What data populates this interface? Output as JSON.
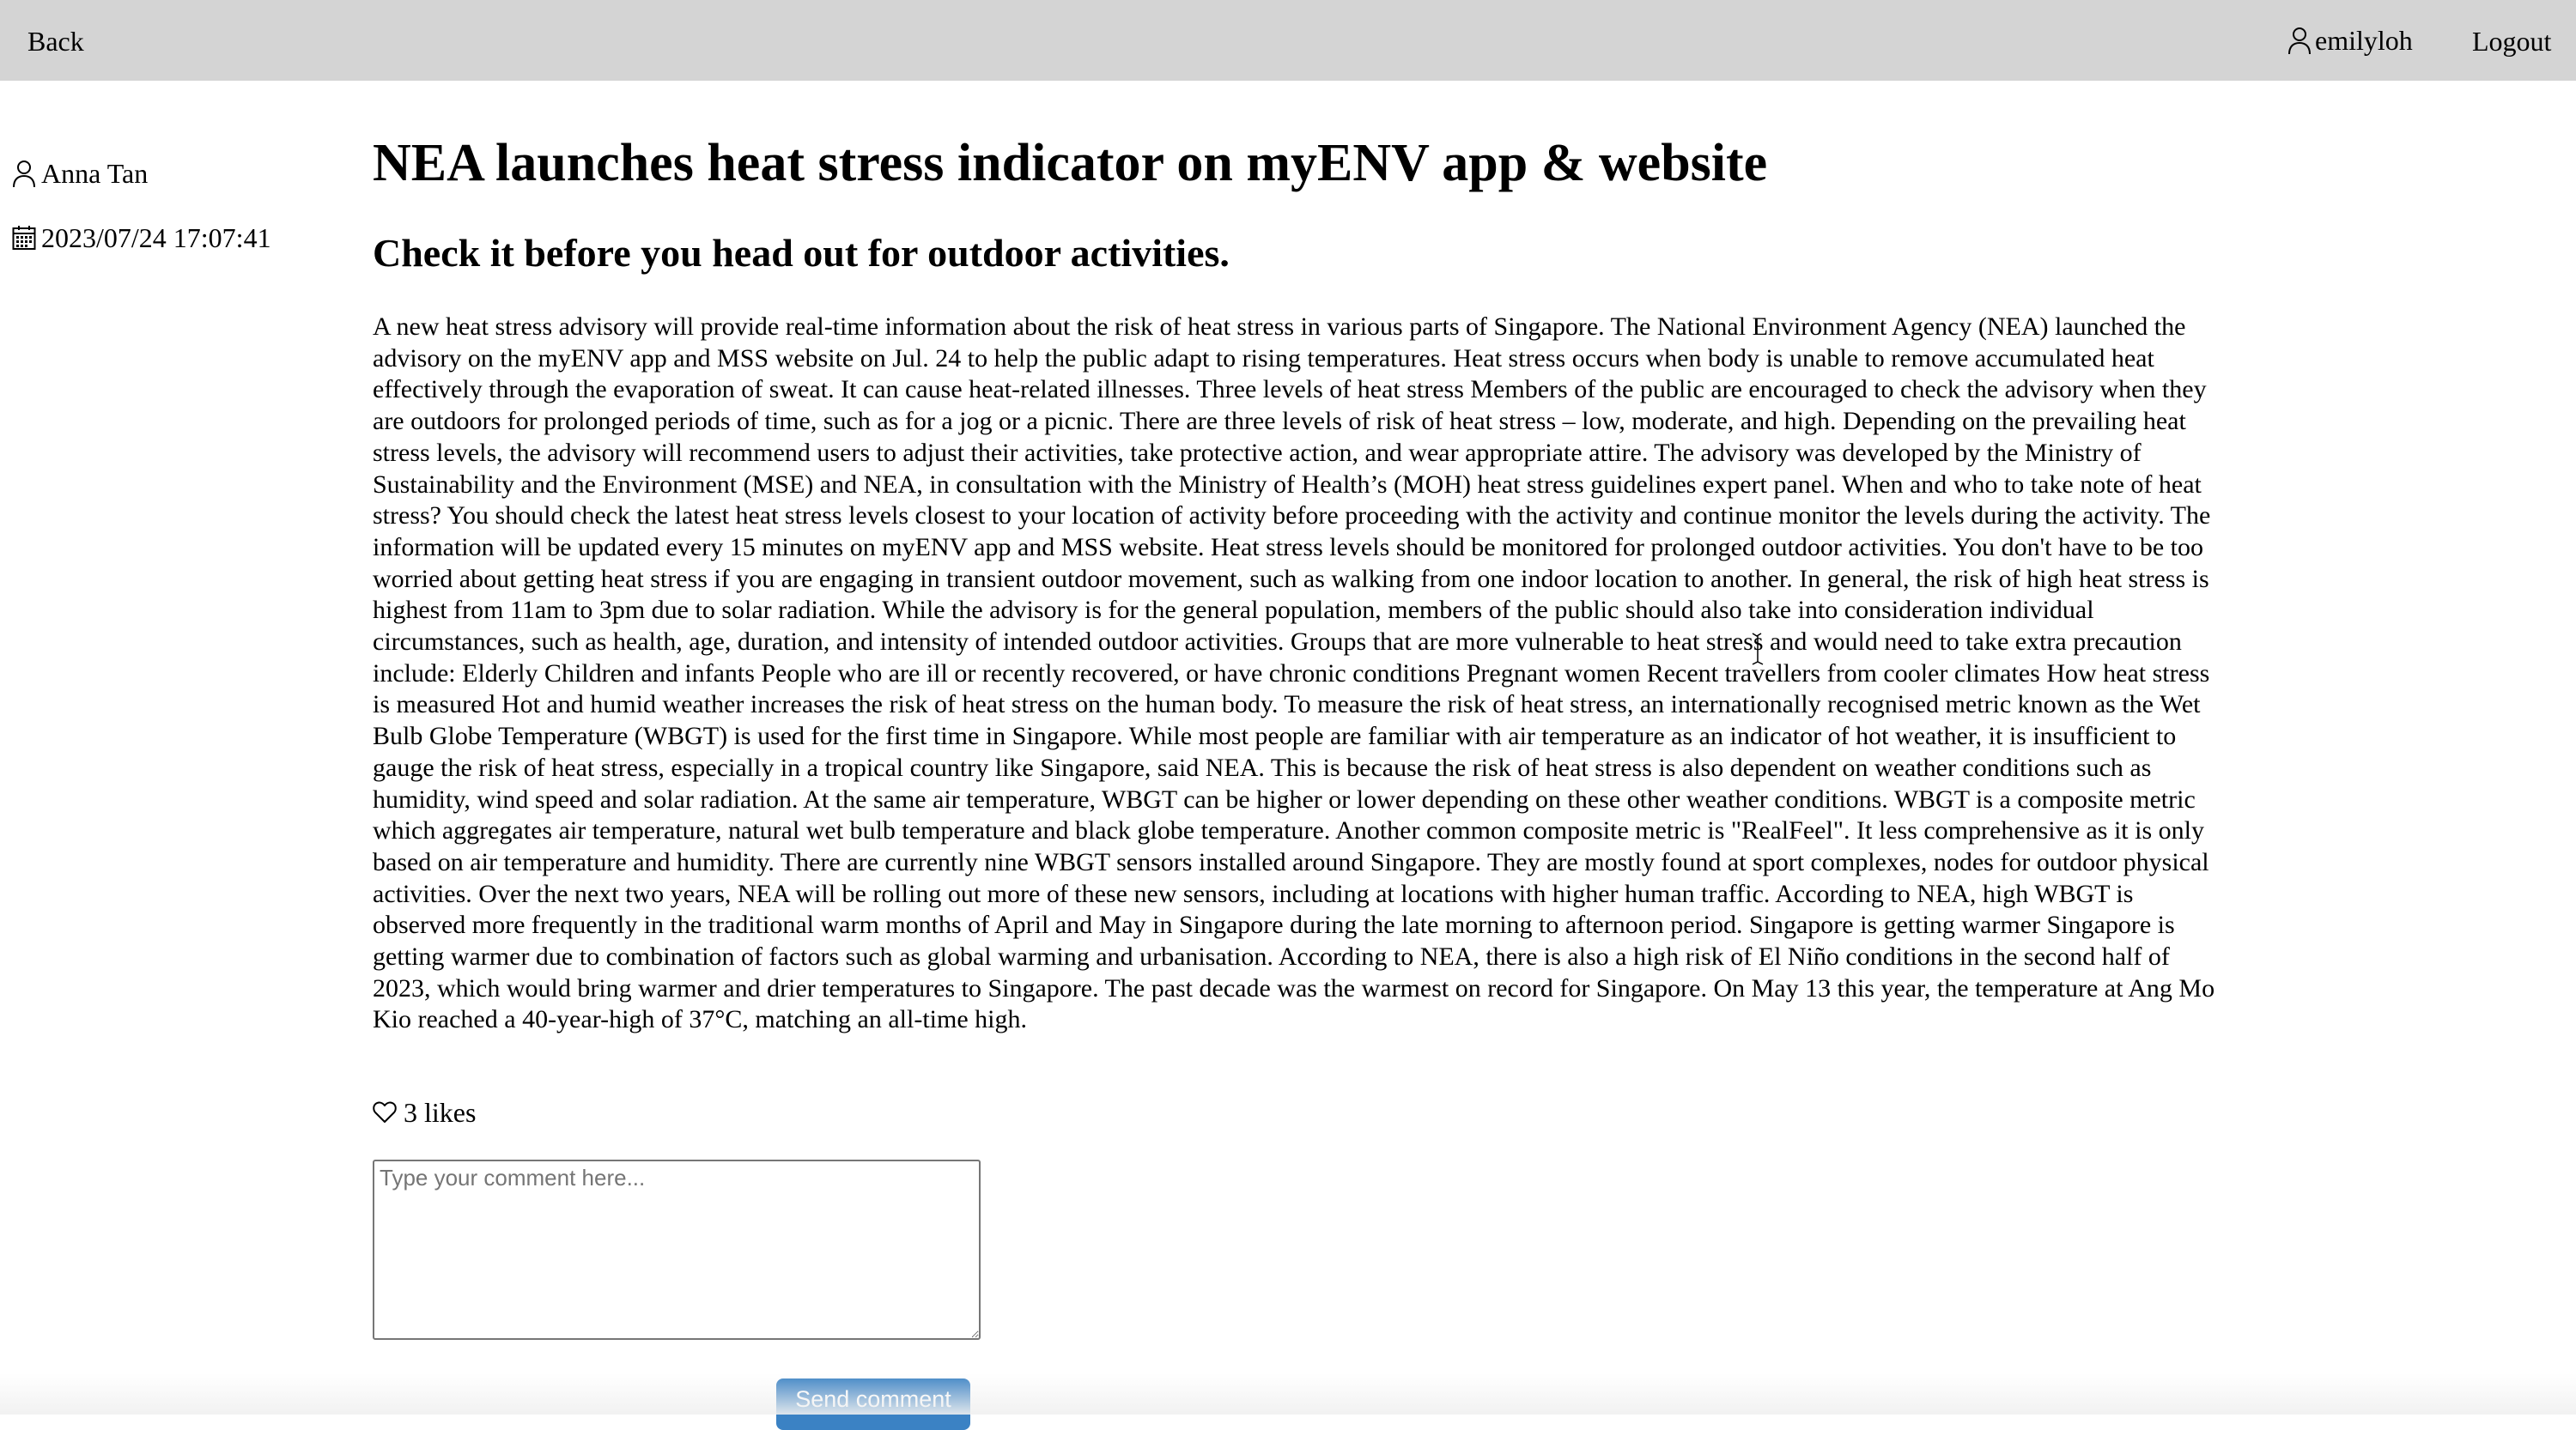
{
  "nav": {
    "back_label": "Back",
    "username": "emilyloh",
    "logout_label": "Logout"
  },
  "post": {
    "author": "Anna Tan",
    "timestamp": "2023/07/24 17:07:41",
    "title": "NEA launches heat stress indicator on myENV app & website",
    "subtitle": "Check it before you head out for outdoor activities.",
    "body": "A new heat stress advisory will provide real-time information about the risk of heat stress in various parts of Singapore. The National Environment Agency (NEA) launched the advisory on the myENV app and MSS website on Jul. 24 to help the public adapt to rising temperatures. Heat stress occurs when body is unable to remove accumulated heat effectively through the evaporation of sweat. It can cause heat-related illnesses. Three levels of heat stress Members of the public are encouraged to check the advisory when they are outdoors for prolonged periods of time, such as for a jog or a picnic. There are three levels of risk of heat stress – low, moderate, and high. Depending on the prevailing heat stress levels, the advisory will recommend users to adjust their activities, take protective action, and wear appropriate attire. The advisory was developed by the Ministry of Sustainability and the Environment (MSE) and NEA, in consultation with the Ministry of Health’s (MOH) heat stress guidelines expert panel. When and who to take note of heat stress? You should check the latest heat stress levels closest to your location of activity before proceeding with the activity and continue monitor the levels during the activity. The information will be updated every 15 minutes on myENV app and MSS website. Heat stress levels should be monitored for prolonged outdoor activities. You don't have to be too worried about getting heat stress if you are engaging in transient outdoor movement, such as walking from one indoor location to another. In general, the risk of high heat stress is highest from 11am to 3pm due to solar radiation. While the advisory is for the general population, members of the public should also take into consideration individual circumstances, such as health, age, duration, and intensity of intended outdoor activities. Groups that are more vulnerable to heat stress and would need to take extra precaution include: Elderly Children and infants People who are ill or recently recovered, or have chronic conditions Pregnant women Recent travellers from cooler climates How heat stress is measured Hot and humid weather increases the risk of heat stress on the human body. To measure the risk of heat stress, an internationally recognised metric known as the Wet Bulb Globe Temperature (WBGT) is used for the first time in Singapore. While most people are familiar with air temperature as an indicator of hot weather, it is insufficient to gauge the risk of heat stress, especially in a tropical country like Singapore, said NEA. This is because the risk of heat stress is also dependent on weather conditions such as humidity, wind speed and solar radiation. At the same air temperature, WBGT can be higher or lower depending on these other weather conditions. WBGT is a composite metric which aggregates air temperature, natural wet bulb temperature and black globe temperature. Another common composite metric is \"RealFeel\". It less comprehensive as it is only based on air temperature and humidity. There are currently nine WBGT sensors installed around Singapore. They are mostly found at sport complexes, nodes for outdoor physical activities. Over the next two years, NEA will be rolling out more of these new sensors, including at locations with higher human traffic. According to NEA, high WBGT is observed more frequently in the traditional warm months of April and May in Singapore during the late morning to afternoon period. Singapore is getting warmer Singapore is getting warmer due to combination of factors such as global warming and urbanisation. According to NEA, there is also a high risk of El Niño conditions in the second half of 2023, which would bring warmer and drier temperatures to Singapore. The past decade was the warmest on record for Singapore. On May 13 this year, the temperature at Ang Mo Kio reached a 40-year-high of 37°C, matching an all-time high.",
    "likes_label": "3 likes"
  },
  "comment": {
    "placeholder": "Type your comment here...",
    "value": "",
    "send_label": "Send comment"
  },
  "colors": {
    "topbar_bg": "#d4d4d4",
    "button_bg": "#3b82c4",
    "button_text": "#ffffff"
  },
  "icons": {
    "user": "person-outline-icon",
    "calendar": "calendar-icon",
    "like": "heart-outline-icon"
  }
}
